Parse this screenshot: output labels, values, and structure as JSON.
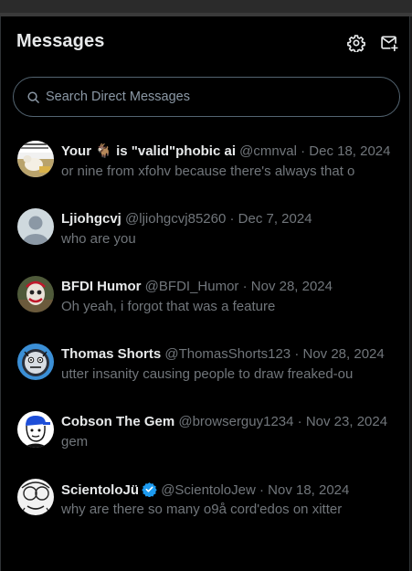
{
  "header": {
    "title": "Messages",
    "settings_icon": "gear-icon",
    "compose_icon": "new-message-icon"
  },
  "search": {
    "placeholder": "Search Direct Messages",
    "value": "",
    "icon": "search-icon"
  },
  "colors": {
    "background": "#000000",
    "text_primary": "#e7e9ea",
    "text_secondary": "#71767b",
    "border": "#2f3336",
    "verified": "#1d9bf0"
  },
  "conversations": [
    {
      "name": "Your 🐐 is \"valid\"phobic ai",
      "handle": "@cmnval",
      "sep": "·",
      "date": "Dec 18, 2024",
      "preview": "or nine from xfohv because there's always that o",
      "verified": false
    },
    {
      "name": "Ljiohgcvj",
      "handle": "@ljiohgcvj85260",
      "sep": "·",
      "date": "Dec 7, 2024",
      "preview": "who are you",
      "verified": false
    },
    {
      "name": "BFDI Humor",
      "handle": "@BFDI_Humor",
      "sep": "·",
      "date": "Nov 28, 2024",
      "preview": "Oh yeah, i forgot that was a feature",
      "verified": false
    },
    {
      "name": "Thomas Shorts",
      "handle": "@ThomasShorts123",
      "sep": "·",
      "date": "Nov 28, 2024",
      "preview": "utter insanity causing people to draw freaked-ou",
      "verified": false
    },
    {
      "name": "Cobson The Gem",
      "handle": "@browserguy1234",
      "sep": "·",
      "date": "Nov 23, 2024",
      "preview": "gem",
      "verified": false
    },
    {
      "name": "ScientoloJü",
      "handle": "@ScientoloJew",
      "sep": "·",
      "date": "Nov 18, 2024",
      "preview": "why are there so many o9å cord'edos on xitter",
      "verified": true
    }
  ]
}
